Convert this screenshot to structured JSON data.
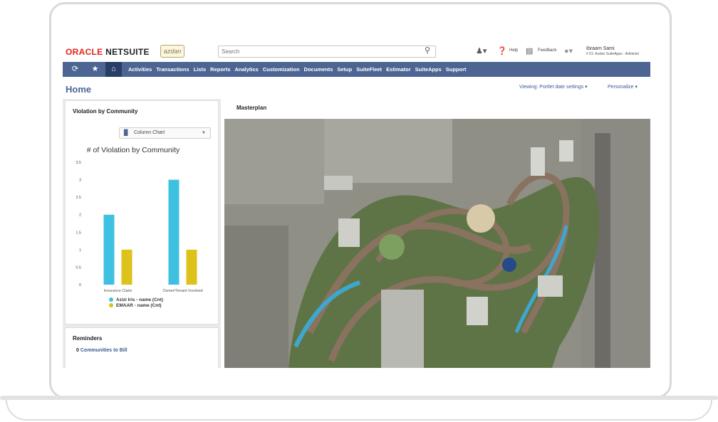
{
  "header": {
    "logo_oracle": "ORACLE",
    "logo_netsuite": "NETSUITE",
    "company_logo_text": "azdan",
    "search_placeholder": "Search",
    "help_label": "Help",
    "feedback_label": "Feedback",
    "user_name": "Ibraam Sami",
    "user_role": "# 01: Azdan SuiteApps - Administ"
  },
  "nav": {
    "items": [
      "Activities",
      "Transactions",
      "Lists",
      "Reports",
      "Analytics",
      "Customization",
      "Documents",
      "Setup",
      "SuiteFleet",
      "Estimator",
      "SuiteApps",
      "Support"
    ]
  },
  "page": {
    "title": "Home",
    "viewing_label": "Viewing: Portlet date settings",
    "personalize_label": "Personalize"
  },
  "violation_portlet": {
    "title": "Violation by Community",
    "chart_type_select": "Column Chart"
  },
  "chart_data": {
    "type": "bar",
    "title": "# of Violation by Community",
    "categories": [
      "Insurance Claim",
      "Owner/Tenant Involved"
    ],
    "series": [
      {
        "name": "Azizi Iris - name (Cnt)",
        "color": "#3ec1e0",
        "values": [
          2,
          3
        ]
      },
      {
        "name": "EMAAR - name (Cnt)",
        "color": "#dcc21a",
        "values": [
          1,
          1
        ]
      }
    ],
    "yticks": [
      "0",
      "0.5",
      "1",
      "1.5",
      "2",
      "2.5",
      "3",
      "3.5"
    ],
    "ylim": [
      0,
      3.5
    ],
    "legend": "bottom",
    "grid": false
  },
  "reminders_portlet": {
    "title": "Reminders",
    "count": "0",
    "link_label": "Communities to Bill"
  },
  "masterplan_portlet": {
    "title": "Masterplan"
  }
}
